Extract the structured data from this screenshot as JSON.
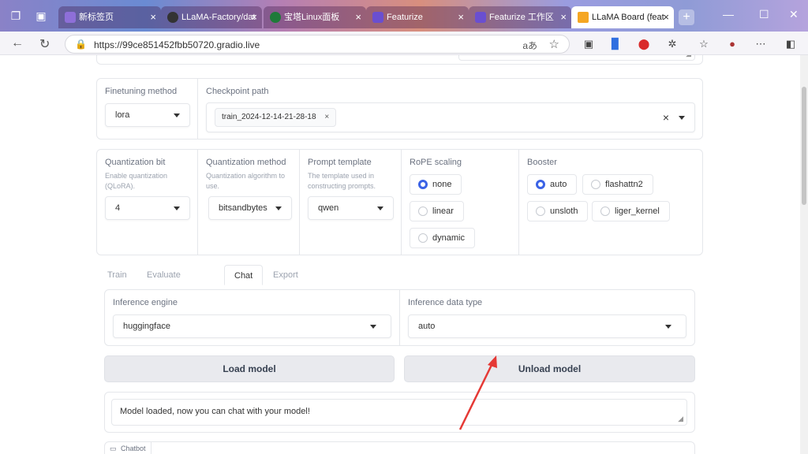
{
  "browser": {
    "tabs": [
      {
        "label": "新标签页",
        "active": false
      },
      {
        "label": "LLaMA-Factory/dat",
        "active": false
      },
      {
        "label": "宝塔Linux面板",
        "active": false
      },
      {
        "label": "Featurize",
        "active": false
      },
      {
        "label": "Featurize 工作区",
        "active": false
      },
      {
        "label": "LLaMA Board (feat",
        "active": true
      }
    ],
    "url": "https://99ce851452fbb50720.gradio.live",
    "new_tab": "+",
    "colors": {
      "accent": "#3b63e6",
      "arrow": "#e53935"
    }
  },
  "row1": {
    "finetuning": {
      "label": "Finetuning method",
      "value": "lora"
    },
    "checkpoint": {
      "label": "Checkpoint path",
      "chip": "train_2024-12-14-21-28-18",
      "chip_close": "×",
      "clear": "×"
    }
  },
  "row2": {
    "quant_bit": {
      "label": "Quantization bit",
      "info": "Enable quantization (QLoRA).",
      "value": "4"
    },
    "quant_method": {
      "label": "Quantization method",
      "info": "Quantization algorithm to use.",
      "value": "bitsandbytes"
    },
    "prompt_template": {
      "label": "Prompt template",
      "info": "The template used in constructing prompts.",
      "value": "qwen"
    },
    "rope": {
      "label": "RoPE scaling",
      "options": [
        "none",
        "linear",
        "dynamic"
      ],
      "selected": "none"
    },
    "booster": {
      "label": "Booster",
      "options": [
        "auto",
        "flashattn2",
        "unsloth",
        "liger_kernel"
      ],
      "selected": "auto"
    }
  },
  "tabs": [
    "Train",
    "Evaluate & Predict",
    "Chat",
    "Export"
  ],
  "active_tab": "Chat",
  "chat": {
    "engine": {
      "label": "Inference engine",
      "value": "huggingface"
    },
    "dtype": {
      "label": "Inference data type",
      "value": "auto"
    },
    "load_button": "Load model",
    "unload_button": "Unload model",
    "info_text": "Model loaded, now you can chat with your model!",
    "chatbot_label": "Chatbot"
  }
}
